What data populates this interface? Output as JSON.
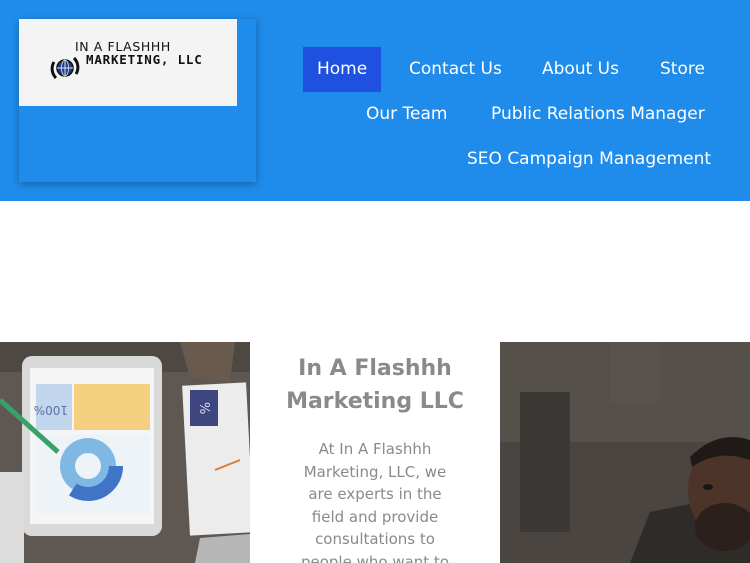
{
  "brand": {
    "logo_line1": "IN A FLASHHH",
    "logo_line2": "MARKETING, LLC"
  },
  "nav": {
    "home": "Home",
    "contact": "Contact Us",
    "about": "About Us",
    "store": "Store",
    "team": "Our Team",
    "pr": "Public Relations Manager",
    "seo": "SEO Campaign Management"
  },
  "colors": {
    "header_bg": "#1f8ceb",
    "active_nav_bg": "#1e51e0",
    "body_text": "#8a8a8a"
  },
  "intro": {
    "title": "In A Flashhh Marketing LLC",
    "body": "At In A Flashhh Marketing, LLC, we are experts in the field and provide consultations to people who want to"
  },
  "images": {
    "left_tablet_percent": "100%",
    "left_card_percent": "%"
  }
}
